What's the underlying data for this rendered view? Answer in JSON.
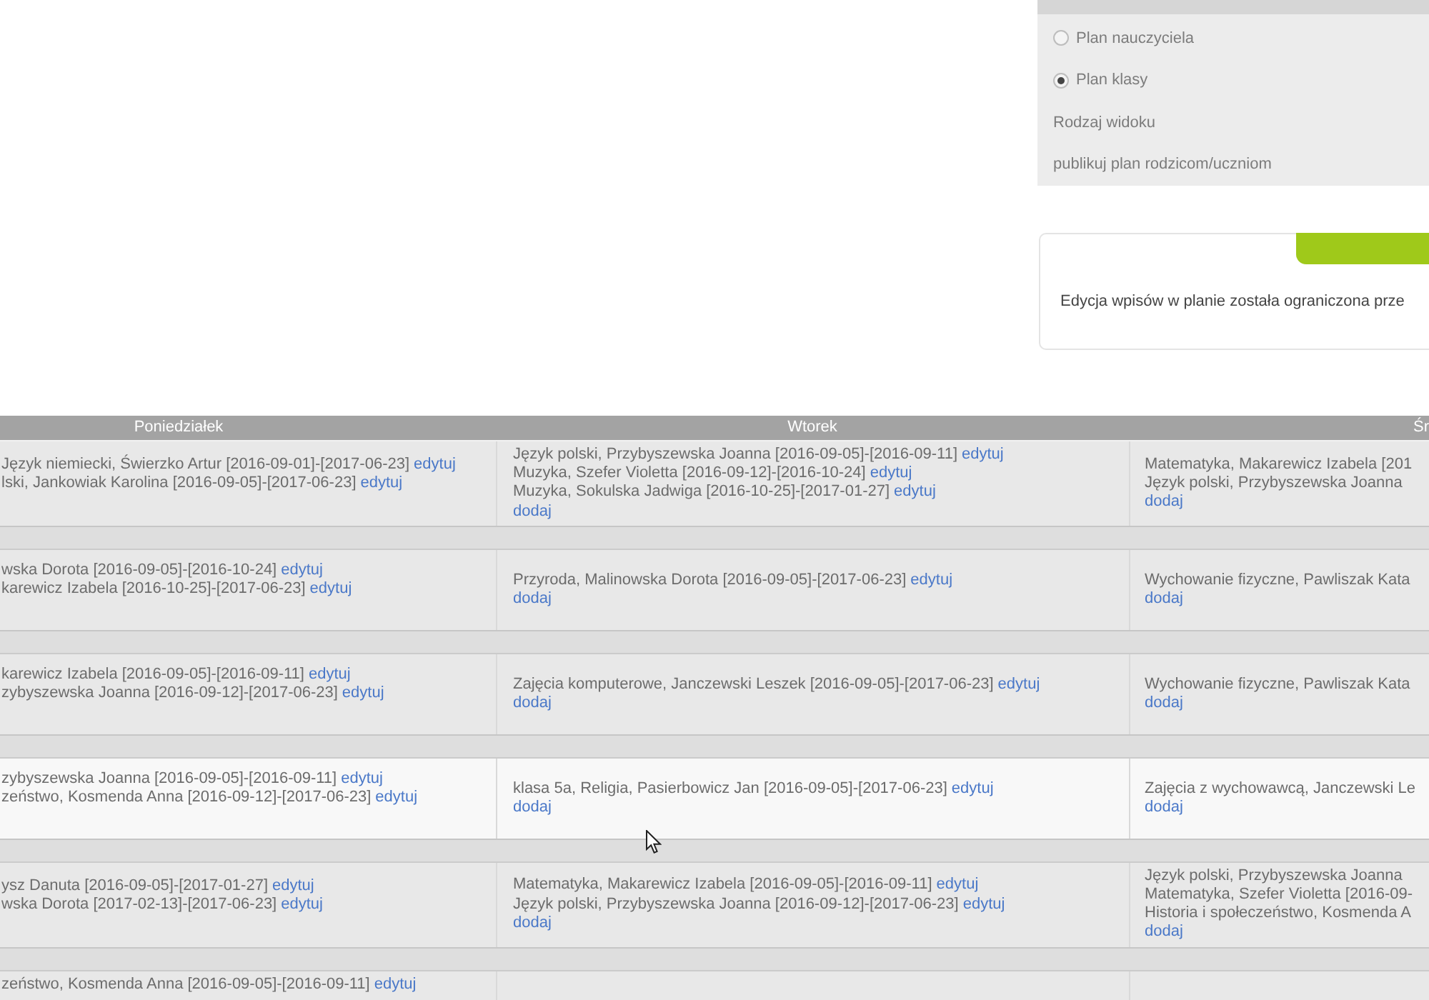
{
  "view_panel": {
    "options": [
      {
        "label": "Plan nauczyciela",
        "selected": false
      },
      {
        "label": "Plan klasy",
        "selected": true
      }
    ],
    "view_type_label": "Rodzaj widoku",
    "publish_label": "publikuj plan rodzicom/uczniom"
  },
  "notice_panel": {
    "message": "Edycja wpisów w planie została ograniczona prze"
  },
  "timetable": {
    "columns": [
      "Poniedziałek",
      "Wtorek",
      "Śr"
    ],
    "rows": [
      {
        "highlighted": false,
        "cells": [
          {
            "entries": [
              {
                "text": "Język niemiecki, Świerzko Artur [2016-09-01]-[2017-06-23]",
                "link": "edytuj"
              },
              {
                "text": "lski, Jankowiak Karolina [2016-09-05]-[2017-06-23]",
                "link": "edytuj"
              }
            ]
          },
          {
            "entries": [
              {
                "text": "Język polski, Przybyszewska Joanna [2016-09-05]-[2016-09-11]",
                "link": "edytuj"
              },
              {
                "text": "Muzyka, Szefer Violetta [2016-09-12]-[2016-10-24]",
                "link": "edytuj"
              },
              {
                "text": "Muzyka, Sokulska Jadwiga [2016-10-25]-[2017-01-27]",
                "link": "edytuj"
              }
            ],
            "add_link": "dodaj"
          },
          {
            "entries": [
              {
                "text": "Matematyka, Makarewicz Izabela [201"
              },
              {
                "text": "Język polski, Przybyszewska Joanna"
              }
            ],
            "add_link": "dodaj"
          }
        ]
      },
      {
        "highlighted": false,
        "cells": [
          {
            "entries": [
              {
                "text": "wska Dorota [2016-09-05]-[2016-10-24]",
                "link": "edytuj"
              },
              {
                "text": "karewicz Izabela [2016-10-25]-[2017-06-23]",
                "link": "edytuj"
              }
            ]
          },
          {
            "entries": [
              {
                "text": "Przyroda, Malinowska Dorota [2016-09-05]-[2017-06-23]",
                "link": "edytuj"
              }
            ],
            "add_link": "dodaj"
          },
          {
            "entries": [
              {
                "text": "Wychowanie fizyczne, Pawliszak Kata"
              }
            ],
            "add_link": "dodaj"
          }
        ]
      },
      {
        "highlighted": false,
        "cells": [
          {
            "entries": [
              {
                "text": "karewicz Izabela [2016-09-05]-[2016-09-11]",
                "link": "edytuj"
              },
              {
                "text": "zybyszewska Joanna [2016-09-12]-[2017-06-23]",
                "link": "edytuj"
              }
            ]
          },
          {
            "entries": [
              {
                "text": "Zajęcia komputerowe, Janczewski Leszek [2016-09-05]-[2017-06-23]",
                "link": "edytuj"
              }
            ],
            "add_link": "dodaj"
          },
          {
            "entries": [
              {
                "text": "Wychowanie fizyczne, Pawliszak Kata"
              }
            ],
            "add_link": "dodaj"
          }
        ]
      },
      {
        "highlighted": true,
        "cells": [
          {
            "entries": [
              {
                "text": "zybyszewska Joanna [2016-09-05]-[2016-09-11]",
                "link": "edytuj"
              },
              {
                "text": "zeństwo, Kosmenda Anna [2016-09-12]-[2017-06-23]",
                "link": "edytuj"
              }
            ]
          },
          {
            "entries": [
              {
                "text": "klasa 5a, Religia, Pasierbowicz Jan [2016-09-05]-[2017-06-23]",
                "link": "edytuj"
              }
            ],
            "add_link": "dodaj"
          },
          {
            "entries": [
              {
                "text": "Zajęcia z wychowawcą, Janczewski Le"
              }
            ],
            "add_link": "dodaj"
          }
        ]
      },
      {
        "highlighted": false,
        "cells": [
          {
            "entries": [
              {
                "text": "ysz Danuta [2016-09-05]-[2017-01-27]",
                "link": "edytuj"
              },
              {
                "text": "wska Dorota [2017-02-13]-[2017-06-23]",
                "link": "edytuj"
              }
            ]
          },
          {
            "entries": [
              {
                "text": "Matematyka, Makarewicz Izabela [2016-09-05]-[2016-09-11]",
                "link": "edytuj"
              },
              {
                "text": "Język polski, Przybyszewska Joanna [2016-09-12]-[2017-06-23]",
                "link": "edytuj"
              }
            ],
            "add_link": "dodaj"
          },
          {
            "entries": [
              {
                "text": "Język polski, Przybyszewska Joanna"
              },
              {
                "text": "Matematyka, Szefer Violetta [2016-09-"
              },
              {
                "text": "Historia i społeczeństwo, Kosmenda A"
              }
            ],
            "add_link": "dodaj"
          }
        ]
      },
      {
        "highlighted": false,
        "cells": [
          {
            "entries": [
              {
                "text": "zeństwo, Kosmenda Anna [2016-09-05]-[2016-09-11]",
                "link": "edytuj"
              }
            ]
          },
          {},
          {}
        ]
      }
    ]
  }
}
